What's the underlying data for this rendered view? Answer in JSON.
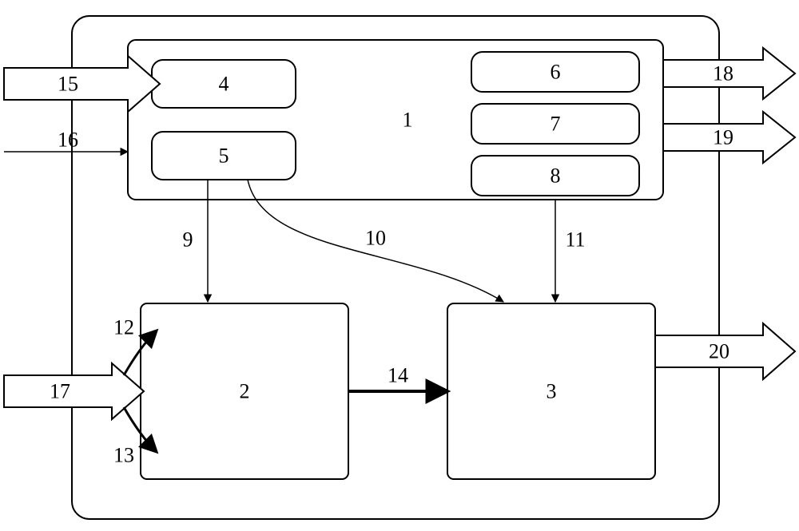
{
  "chart_data": {
    "type": "diagram",
    "title": "",
    "outer_container": {
      "id": 0,
      "bounds": "main-frame"
    },
    "top_module": {
      "id": 1,
      "label": "1",
      "subblocks_left": [
        {
          "id": 4,
          "label": "4"
        },
        {
          "id": 5,
          "label": "5"
        }
      ],
      "subblocks_right": [
        {
          "id": 6,
          "label": "6"
        },
        {
          "id": 7,
          "label": "7"
        },
        {
          "id": 8,
          "label": "8"
        }
      ]
    },
    "bottom_blocks": [
      {
        "id": 2,
        "label": "2"
      },
      {
        "id": 3,
        "label": "3"
      }
    ],
    "external_inputs": [
      {
        "id": 15,
        "label": "15",
        "type": "thick-arrow",
        "target": 4
      },
      {
        "id": 16,
        "label": "16",
        "type": "thin-arrow",
        "target": 5
      },
      {
        "id": 17,
        "label": "17",
        "type": "thick-arrow",
        "target": 2
      }
    ],
    "external_outputs": [
      {
        "id": 18,
        "label": "18",
        "type": "thick-arrow",
        "source": 6
      },
      {
        "id": 19,
        "label": "19",
        "type": "thick-arrow",
        "source": 7
      },
      {
        "id": 20,
        "label": "20",
        "type": "thick-arrow",
        "source": 3
      }
    ],
    "internal_connectors": [
      {
        "id": 9,
        "label": "9",
        "from": 5,
        "to": 2,
        "style": "thin-arrow"
      },
      {
        "id": 10,
        "label": "10",
        "from": 5,
        "to": 3,
        "style": "thin-curved-arrow"
      },
      {
        "id": 11,
        "label": "11",
        "from": 8,
        "to": 3,
        "style": "thin-arrow"
      },
      {
        "id": 12,
        "label": "12",
        "from": 17,
        "to": "2-top",
        "style": "curved-bold"
      },
      {
        "id": 13,
        "label": "13",
        "from": 17,
        "to": "2-bottom",
        "style": "curved-bold"
      },
      {
        "id": 14,
        "label": "14",
        "from": 2,
        "to": 3,
        "style": "thick-arrow"
      }
    ]
  },
  "labels": {
    "n1": "1",
    "n2": "2",
    "n3": "3",
    "n4": "4",
    "n5": "5",
    "n6": "6",
    "n7": "7",
    "n8": "8",
    "n9": "9",
    "n10": "10",
    "n11": "11",
    "n12": "12",
    "n13": "13",
    "n14": "14",
    "n15": "15",
    "n16": "16",
    "n17": "17",
    "n18": "18",
    "n19": "19",
    "n20": "20"
  }
}
